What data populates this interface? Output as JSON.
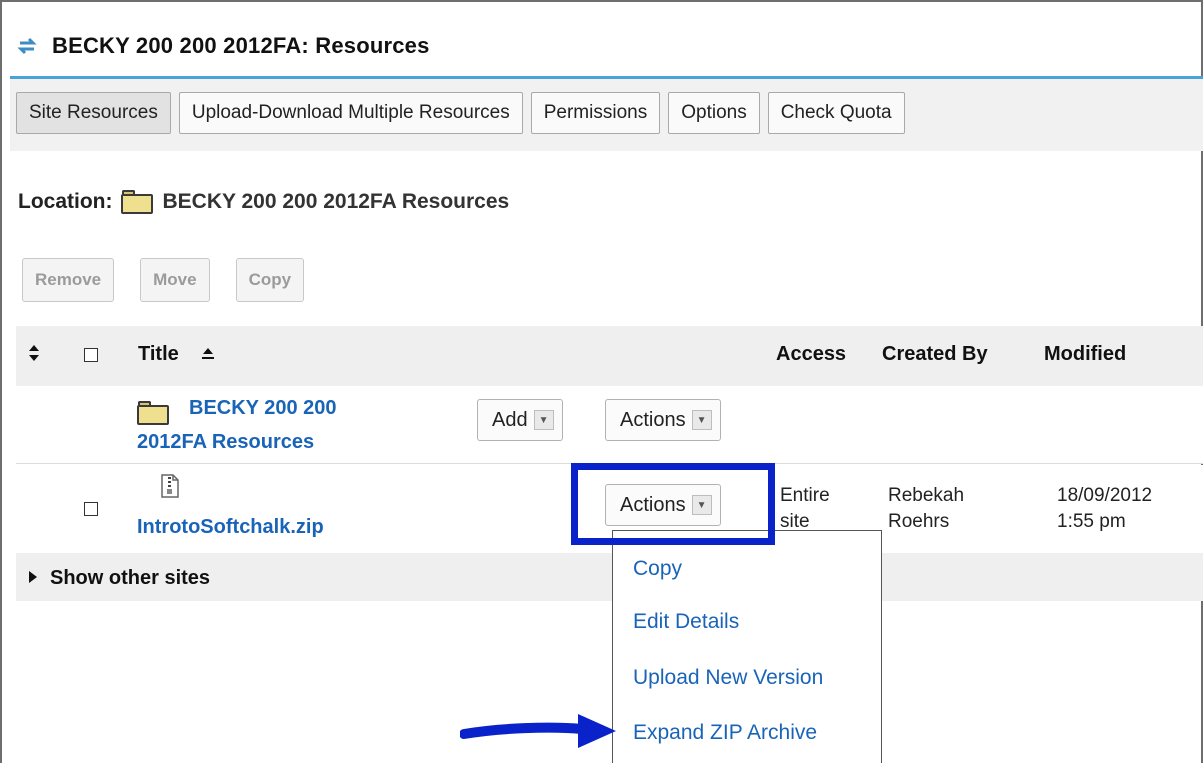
{
  "header": {
    "title": "BECKY 200 200 2012FA: Resources"
  },
  "tabs": [
    {
      "label": "Site Resources"
    },
    {
      "label": "Upload-Download Multiple Resources"
    },
    {
      "label": "Permissions"
    },
    {
      "label": "Options"
    },
    {
      "label": "Check Quota"
    }
  ],
  "location": {
    "label": "Location:",
    "value": "BECKY 200 200 2012FA Resources"
  },
  "bulk_actions": {
    "remove": "Remove",
    "move": "Move",
    "copy": "Copy"
  },
  "table": {
    "headers": {
      "title": "Title",
      "access": "Access",
      "created_by": "Created By",
      "modified": "Modified"
    },
    "folder_row": {
      "title_line1": "BECKY 200 200",
      "title_line2": "2012FA Resources",
      "add": "Add",
      "actions": "Actions"
    },
    "file_row": {
      "title": "IntrotoSoftchalk.zip",
      "actions": "Actions",
      "access_line1": "Entire",
      "access_line2": "site",
      "created_by_line1": "Rebekah",
      "created_by_line2": "Roehrs",
      "modified_line1": "18/09/2012",
      "modified_line2": "1:55 pm"
    },
    "show_other_sites": "Show other sites"
  },
  "actions_menu": {
    "items": [
      "Copy",
      "Edit Details",
      "Upload New Version",
      "Expand ZIP Archive"
    ]
  },
  "colors": {
    "link": "#1a64b8",
    "highlight": "#0a22c9",
    "rule": "#4aa3d6"
  }
}
